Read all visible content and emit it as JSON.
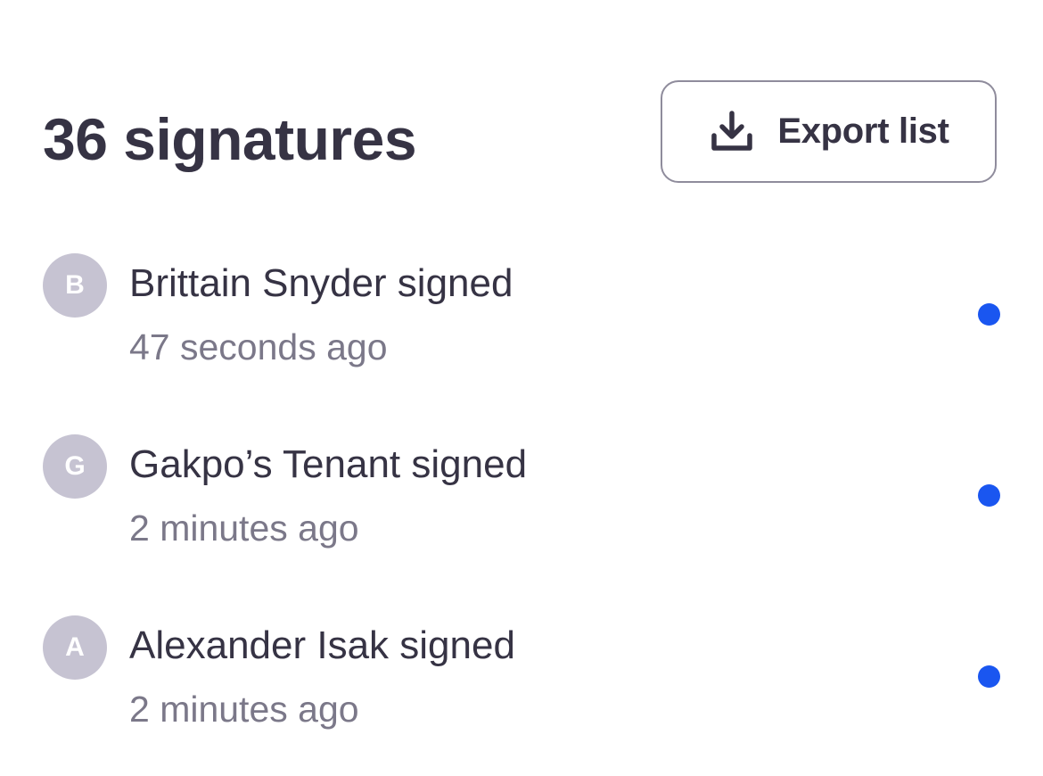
{
  "header": {
    "title": "36 signatures",
    "export_label": "Export list"
  },
  "colors": {
    "accent_dot": "#1a56f0",
    "avatar_bg": "#c6c3d2",
    "text_primary": "#363344",
    "text_secondary": "#7b7889"
  },
  "signatures": [
    {
      "initial": "B",
      "text": "Brittain Snyder signed",
      "time": "47 seconds ago",
      "unread": true
    },
    {
      "initial": "G",
      "text": "Gakpo’s Tenant signed",
      "time": "2 minutes ago",
      "unread": true
    },
    {
      "initial": "A",
      "text": "Alexander Isak signed",
      "time": "2 minutes ago",
      "unread": true
    }
  ]
}
